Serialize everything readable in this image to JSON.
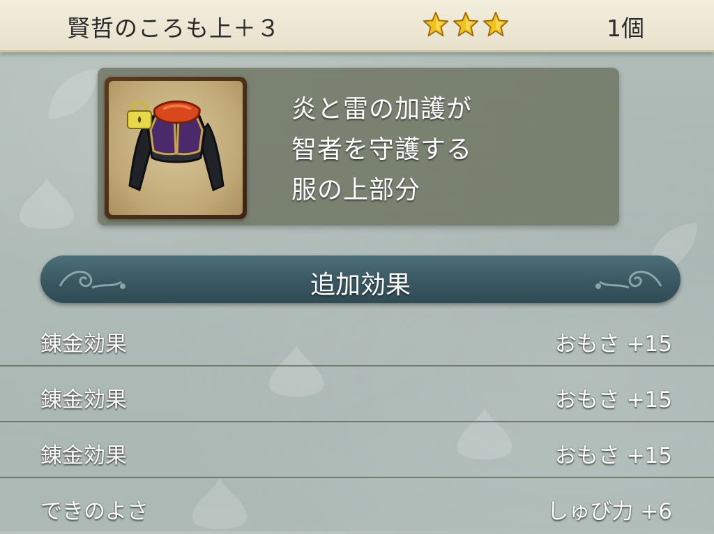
{
  "header": {
    "title": "賢哲のころも上＋３",
    "rating_stars": 3,
    "count": "1個"
  },
  "item": {
    "icon": "robe-top-icon",
    "locked": true,
    "description_lines": [
      "炎と雷の加護が",
      "智者を守護する",
      "服の上部分"
    ]
  },
  "section": {
    "title": "追加効果"
  },
  "effects": [
    {
      "label": "錬金効果",
      "value": "おもさ +15"
    },
    {
      "label": "錬金効果",
      "value": "おもさ +15"
    },
    {
      "label": "錬金効果",
      "value": "おもさ +15"
    },
    {
      "label": "できのよさ",
      "value": "しゅび力 +6"
    }
  ],
  "colors": {
    "header_bg": "#efe9d5",
    "section_bar": "#3a5862",
    "star": "#f2c21c",
    "background": "#aab7b3"
  }
}
